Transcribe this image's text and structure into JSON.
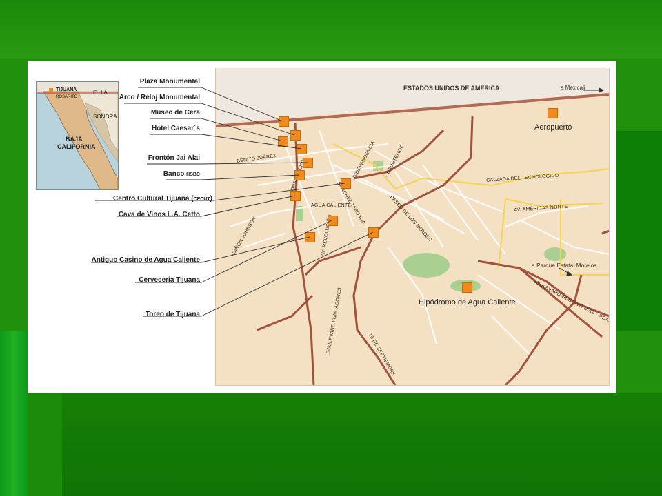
{
  "colors": {
    "slide_green": "#1f8f0c",
    "map_beige": "#f4e0c3",
    "road_brown": "#a0523c",
    "road_yellow": "#f3d45a",
    "marker_orange": "#ef8a1e",
    "park_green": "#a9cf91"
  },
  "inset": {
    "tijuana": "TIJUANA",
    "rosarito": "ROSARITO",
    "eua": "E.U.A",
    "sonora": "SONORA",
    "baja_line1": "BAJA",
    "baja_line2": "CALIFORNIA"
  },
  "map": {
    "border_label": "ESTADOS UNIDOS DE AMÉRICA",
    "to_mexicali": "a Mexicali",
    "airport": "Aeropuerto",
    "hipodromo": "Hipódromo de Agua Caliente",
    "to_parque": "a Parque Estatal Morelos",
    "streets": {
      "benito_juarez": "BENITO JUÁREZ",
      "constitucion": "CONSTITUCIÓN",
      "independencia": "INDEPENDENCIA",
      "cuauhtemoc": "CUAUHTÉMOC",
      "calzada": "CALZADA DEL TECNOLÓGICO",
      "americas": "AV. AMÉRICAS NORTE",
      "agua_caliente": "AGUA CALIENTE",
      "sanchez": "SÁNCHEZ TABOADA",
      "paseo": "PASEO DE LOS HEROES",
      "canon": "CAÑÓN JOHNSON",
      "revolucion": "AV. REVOLUCIÓN",
      "fundadores": "BOULEVARD FUNDADORES",
      "septiembre": "16 DE SEPTIEMBRE",
      "diaz_ordaz": "BOULEVARD GUSTAVO DÍAZ ORDAZ"
    }
  },
  "callouts": {
    "plaza": "Plaza Monumental",
    "arco": "Arco / Reloj Monumental",
    "museo": "Museo de Cera",
    "hotel": "Hotel Caesar´s",
    "fronton": "Frontón Jai Alai",
    "banco": "Banco",
    "banco_small": "HSBC",
    "centro": "Centro Cultural Tijuana (",
    "centro_small": "CECUT",
    "centro_end": ")",
    "cava": "Cava de Vinos L.A. Cetto",
    "casino": "Antiguo Casino de Agua Caliente",
    "cerveceria": "Cerveceria Tijuana",
    "toreo": "Toreo de Tijuana"
  }
}
